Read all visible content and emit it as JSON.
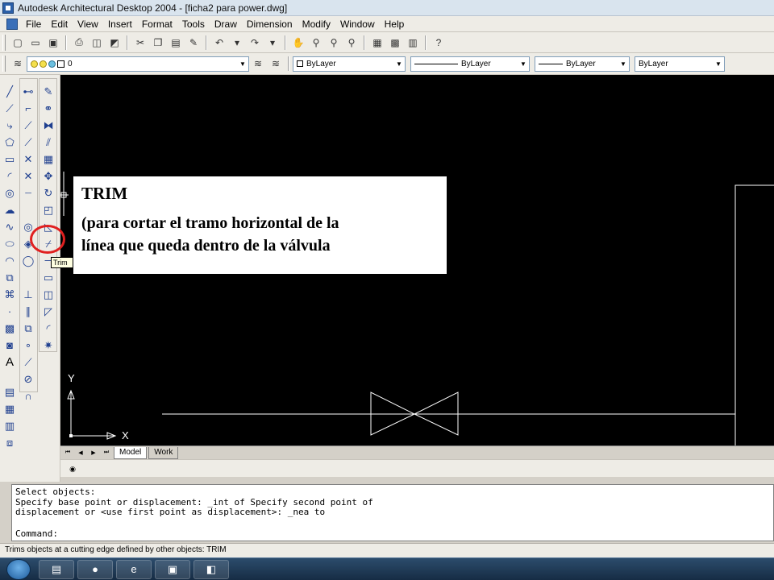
{
  "window": {
    "title": "Autodesk Architectural Desktop 2004 - [ficha2 para power.dwg]"
  },
  "menu": [
    "File",
    "Edit",
    "View",
    "Insert",
    "Format",
    "Tools",
    "Draw",
    "Dimension",
    "Modify",
    "Window",
    "Help"
  ],
  "toolbar": {
    "layer_value": "0",
    "color_value": "ByLayer",
    "linetype_value": "ByLayer",
    "lineweight_value": "ByLayer",
    "plotstyle_value": "ByLayer"
  },
  "canvas": {
    "ucs_y_label": "Y",
    "ucs_x_label": "X"
  },
  "layout_tabs": [
    "Model",
    "Work"
  ],
  "tooltip": "Trim",
  "callout": {
    "title": "TRIM",
    "body_line1": "(para cortar el tramo horizontal de la",
    "body_line2": "línea que queda dentro de la válvula"
  },
  "command_window": {
    "line1": "Select objects:",
    "line2": "Specify base point or displacement: _int of Specify second point of",
    "line3": "displacement or <use first point as displacement>: _nea to",
    "prompt": "Command:"
  },
  "status": {
    "text": "Trims objects at a cutting edge defined by other objects:  TRIM"
  },
  "colors": {
    "canvas_bg": "#000000",
    "highlight": "#e02020",
    "tooltip_bg": "#ffffe1"
  },
  "icons": {
    "draw_tools": [
      "line-icon",
      "construction-line-icon",
      "polyline-icon",
      "polygon-icon",
      "rectangle-icon",
      "arc-icon",
      "circle-icon",
      "revision-cloud-icon",
      "spline-icon",
      "ellipse-icon",
      "ellipse-arc-icon",
      "insert-block-icon",
      "make-block-icon",
      "point-icon",
      "hatch-icon",
      "region-icon",
      "text-icon"
    ],
    "modify_tools": [
      "erase-icon",
      "copy-icon",
      "mirror-icon",
      "offset-icon",
      "array-icon",
      "move-icon",
      "rotate-icon",
      "scale-icon",
      "stretch-icon",
      "trim-icon",
      "extend-icon",
      "break-icon",
      "join-icon",
      "chamfer-icon",
      "fillet-icon",
      "explode-icon"
    ]
  }
}
